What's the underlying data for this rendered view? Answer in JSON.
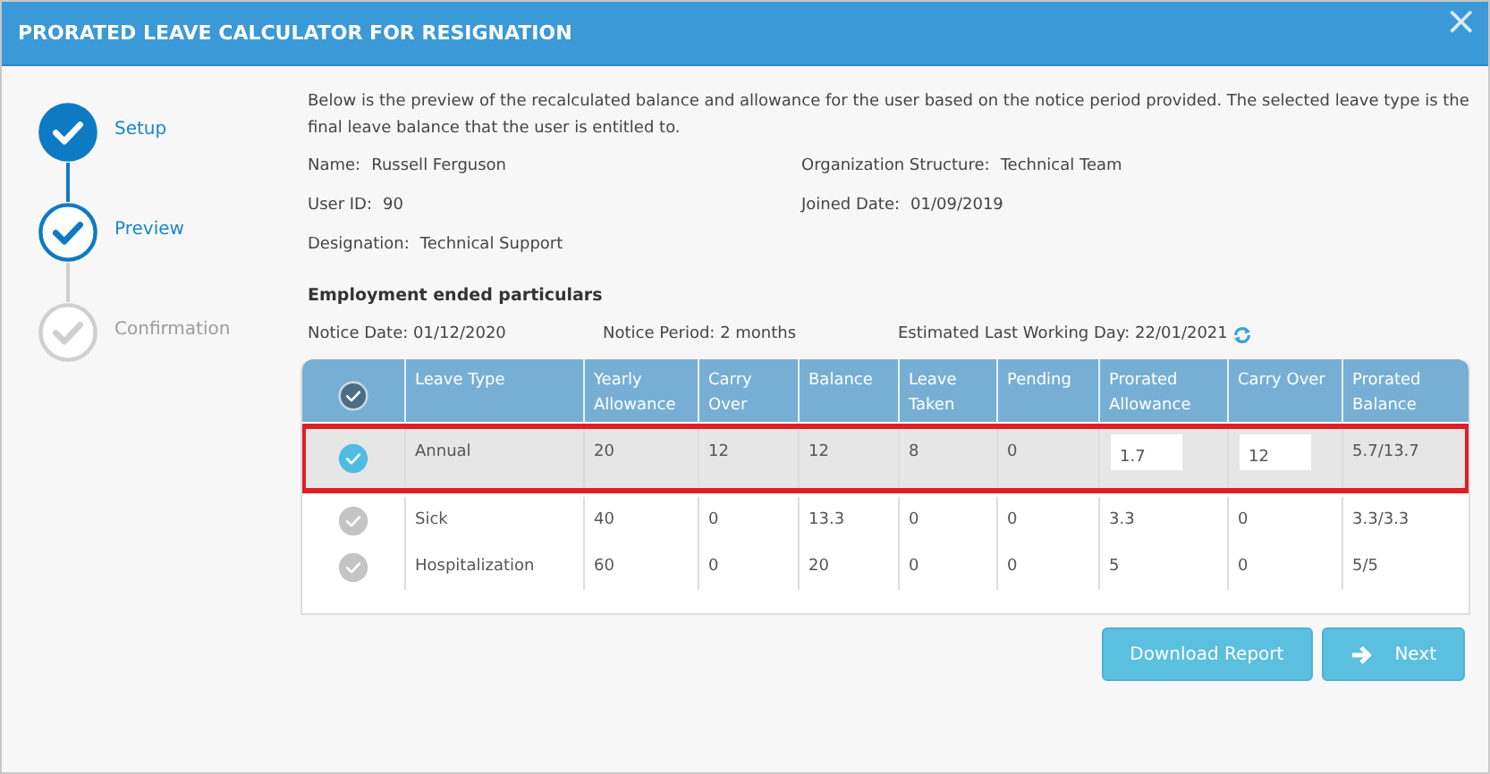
{
  "window": {
    "title": "PRORATED LEAVE CALCULATOR FOR RESIGNATION",
    "close_glyph": "×"
  },
  "steps": [
    {
      "label": "Setup",
      "completed": true,
      "selected": false
    },
    {
      "label": "Preview",
      "completed": false,
      "selected": true
    },
    {
      "label": "Confirmation",
      "completed": false,
      "selected": false
    }
  ],
  "intro": "Below is the preview of the recalculated balance and allowance for the user based on the notice period provided. The selected leave type is the final leave balance that the user is entitled to.",
  "details": [
    {
      "label": "Name:",
      "value": "Russell Ferguson"
    },
    {
      "label": "Organization Structure:",
      "value": "Technical Team"
    },
    {
      "label": "User ID:",
      "value": "90"
    },
    {
      "label": "Joined Date:",
      "value": "01/09/2019"
    },
    {
      "label": "Designation:",
      "value": "Technical Support"
    }
  ],
  "employment": {
    "heading": "Employment ended particulars",
    "notice_date": "Notice Date: 01/12/2020",
    "notice_period": "Notice Period: 2 months",
    "last_working_day": "Estimated Last Working Day: 22/01/2021"
  },
  "table": {
    "header_checked": true,
    "columns": [
      "Leave Type",
      "Yearly Allowance",
      "Carry Over",
      "Balance",
      "Leave Taken",
      "Pending",
      "Prorated Allowance",
      "Carry Over",
      "Prorated Balance"
    ],
    "rows": [
      {
        "selected": true,
        "checked": true,
        "editable": true,
        "cells": [
          "Annual",
          "20",
          "12",
          "12",
          "8",
          "0",
          "1.7",
          "12",
          "5.7/13.7"
        ]
      },
      {
        "selected": false,
        "checked": false,
        "editable": false,
        "cells": [
          "Sick",
          "40",
          "0",
          "13.3",
          "0",
          "0",
          "3.3",
          "0",
          "3.3/3.3"
        ]
      },
      {
        "selected": false,
        "checked": false,
        "editable": false,
        "cells": [
          "Hospitalization",
          "60",
          "0",
          "20",
          "0",
          "0",
          "5",
          "0",
          "5/5"
        ]
      }
    ]
  },
  "buttons": [
    {
      "label": "Download Report",
      "kind": "plain"
    },
    {
      "label": "Next",
      "kind": "arrow"
    }
  ]
}
